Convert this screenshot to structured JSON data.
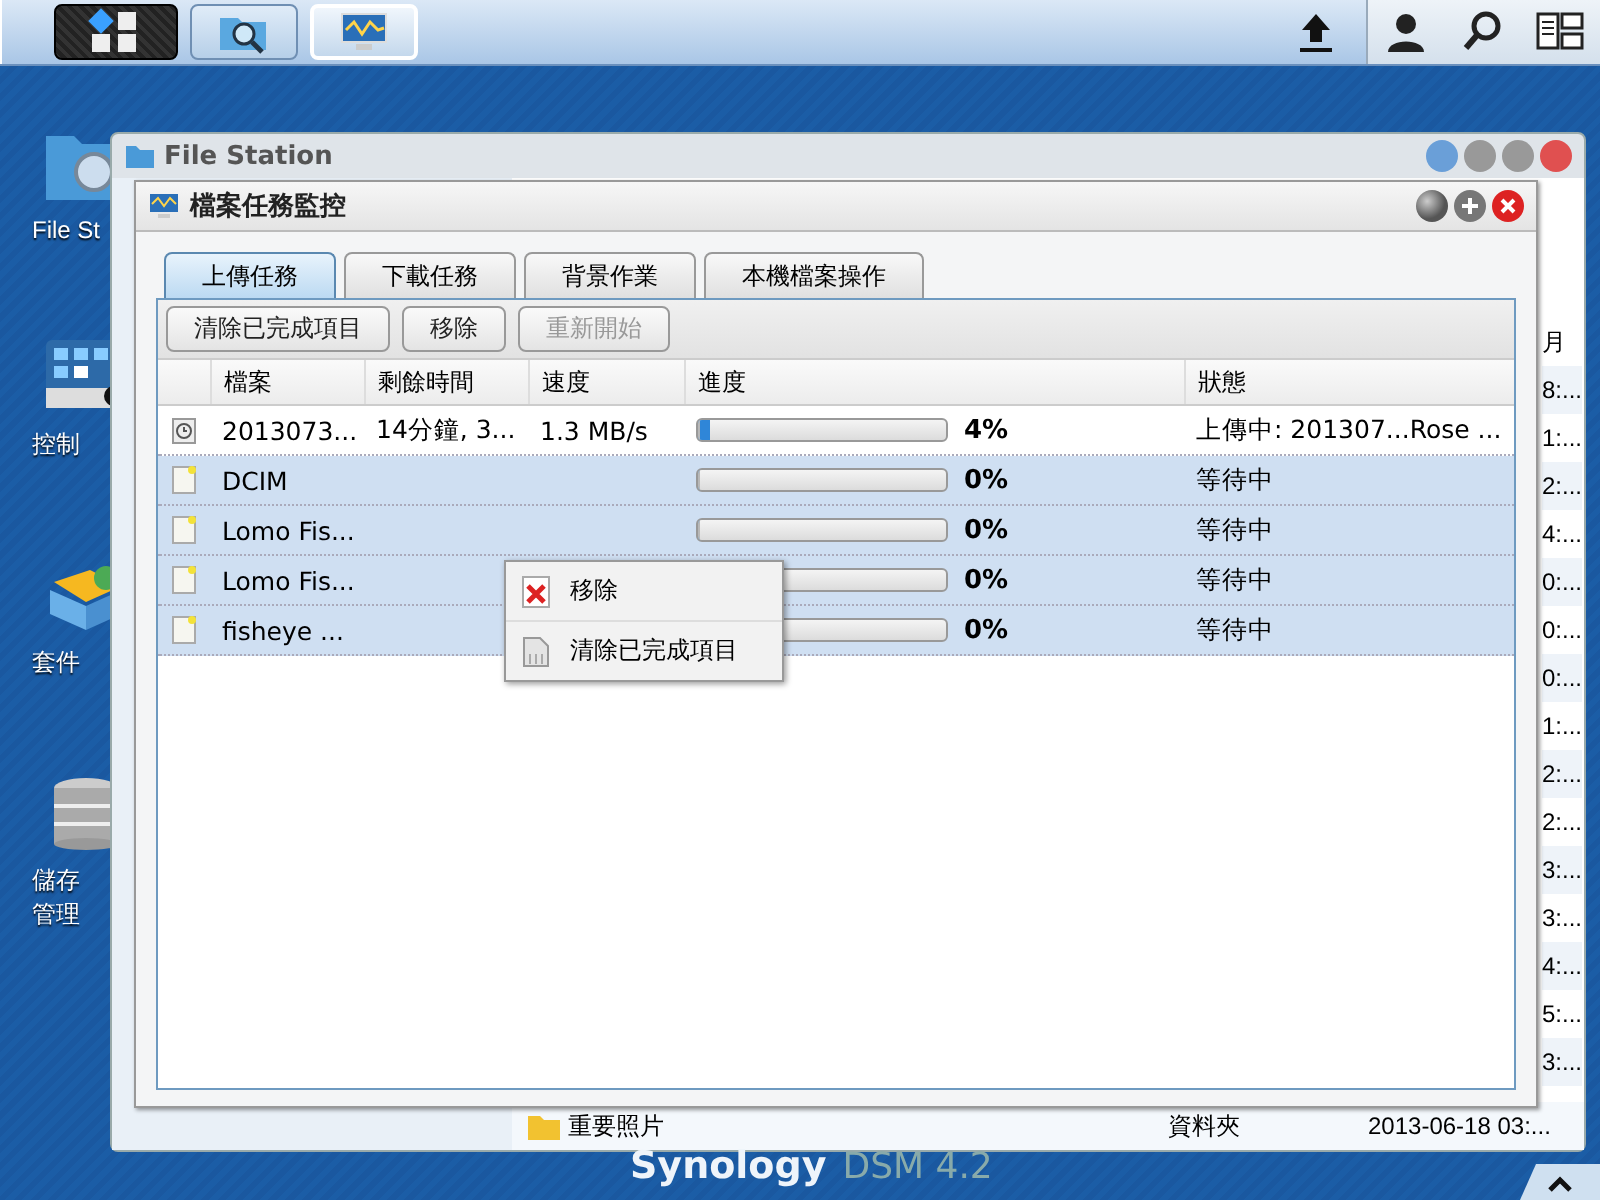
{
  "desktop_icons": [
    {
      "kind": "folder",
      "lines": [
        "File St"
      ]
    },
    {
      "kind": "control",
      "lines": [
        "控制"
      ]
    },
    {
      "kind": "package",
      "lines": [
        "套件"
      ]
    },
    {
      "kind": "storage",
      "lines": [
        "儲存",
        "管理"
      ]
    }
  ],
  "file_station": {
    "title": "File Station",
    "column_header": "月",
    "times": [
      "8:...",
      "1:...",
      "2:...",
      "4:...",
      "0:...",
      "0:...",
      "0:...",
      "1:...",
      "2:...",
      "2:...",
      "3:...",
      "3:...",
      "4:...",
      "5:...",
      "3:..."
    ],
    "bottom_row": {
      "name": "重要照片",
      "type": "資料夾",
      "date": "2013-06-18 03:..."
    }
  },
  "monitor": {
    "title": "檔案任務監控",
    "tabs": [
      {
        "label": "上傳任務",
        "selected": true
      },
      {
        "label": "下載任務",
        "selected": false
      },
      {
        "label": "背景作業",
        "selected": false
      },
      {
        "label": "本機檔案操作",
        "selected": false
      }
    ],
    "buttons": [
      {
        "label": "清除已完成項目",
        "disabled": false
      },
      {
        "label": "移除",
        "disabled": false
      },
      {
        "label": "重新開始",
        "disabled": true
      }
    ],
    "columns": [
      "檔案",
      "剩餘時間",
      "速度",
      "進度",
      "狀態"
    ],
    "rows": [
      {
        "kind": "uploading",
        "file": "2013073...",
        "remaining": "14分鐘, 3...",
        "speed": "1.3 MB/s",
        "level": 0.04,
        "percent": "4%",
        "status": "上傳中: 201307...Rose ...",
        "selected": false
      },
      {
        "kind": "waiting",
        "file": "DCIM",
        "level": 0,
        "percent": "0%",
        "status": "等待中",
        "selected": true
      },
      {
        "kind": "waiting",
        "file": "Lomo Fis...",
        "level": 0,
        "percent": "0%",
        "status": "等待中",
        "selected": true
      },
      {
        "kind": "waiting",
        "file": "Lomo Fis...",
        "level": 0,
        "percent": "0%",
        "status": "等待中",
        "selected": true
      },
      {
        "kind": "waiting",
        "file": "fisheye ...",
        "level": 0,
        "percent": "0%",
        "status": "等待中",
        "selected": true
      }
    ]
  },
  "context_menu": [
    {
      "kind": "remove",
      "label": "移除"
    },
    {
      "kind": "clear",
      "label": "清除已完成項目"
    }
  ],
  "footer": {
    "brand": "Synology",
    "product": "DSM 4.2"
  }
}
